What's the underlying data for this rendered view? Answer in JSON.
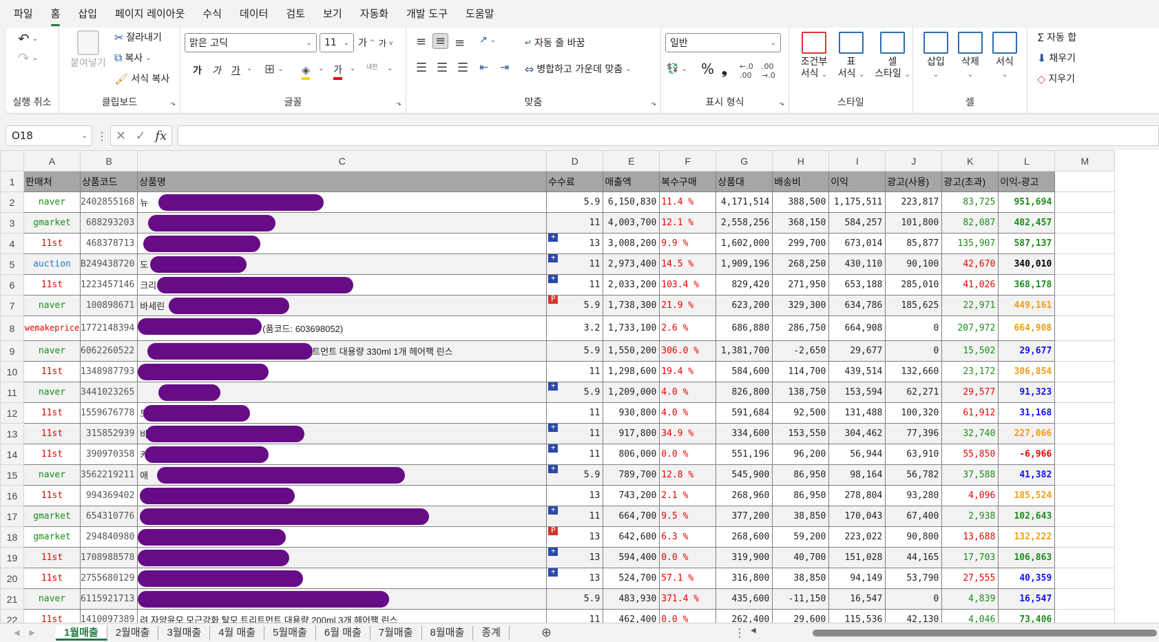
{
  "menu": [
    "파일",
    "홈",
    "삽입",
    "페이지 레이아웃",
    "수식",
    "데이터",
    "검토",
    "보기",
    "자동화",
    "개발 도구",
    "도움말"
  ],
  "ribbon": {
    "undo_group": "실행 취소",
    "clipboard_group": "클립보드",
    "paste": "붙여넣기",
    "cut": "잘라내기",
    "copy": "복사",
    "format_painter": "서식 복사",
    "font_group": "글꼴",
    "font_name": "맑은 고딕",
    "font_size": "11",
    "bold": "가",
    "italic": "가",
    "underline": "가",
    "font_color": "가",
    "phonetic": "내천",
    "align_group": "맞춤",
    "wrap_text": "자동 줄 바꿈",
    "merge_center": "병합하고 가운데 맞춤",
    "number_group": "표시 형식",
    "number_format": "일반",
    "percent": "%",
    "comma": "❟",
    "style_group": "스타일",
    "conditional": [
      "조건부",
      "서식"
    ],
    "table_fmt": [
      "표",
      "서식"
    ],
    "cell_style": [
      "셀",
      "스타일"
    ],
    "cells_group": "셀",
    "insert": "삽입",
    "delete": "삭제",
    "format": "서식",
    "autosum": "자동 합",
    "fill": "채우기",
    "clear": "지우기"
  },
  "formula_bar": {
    "name_box": "O18",
    "fx": "fx"
  },
  "columns": [
    "A",
    "B",
    "C",
    "D",
    "E",
    "F",
    "G",
    "H",
    "I",
    "J",
    "K",
    "L",
    "M"
  ],
  "header_row": [
    "판매처",
    "상품코드",
    "상품명",
    "수수료",
    "매출액",
    "복수구매",
    "상품대",
    "배송비",
    "이익",
    "광고(사용)",
    "광고(초과)",
    "이익-광고"
  ],
  "rows": [
    {
      "n": "2",
      "seller": "naver",
      "sc": "green",
      "code": "2402855168",
      "name": "뉴",
      "rw": 240,
      "rl": 30,
      "mark": "",
      "fee": "5.9",
      "sales": "6,150,830",
      "multi": "11.4 %",
      "goods": "4,171,514",
      "ship": "388,500",
      "profit": "1,175,511",
      "ad": "223,817",
      "over": "83,725",
      "net": "951,694",
      "nc": "green"
    },
    {
      "n": "3",
      "seller": "gmarket",
      "sc": "green",
      "code": "688293203",
      "name": "",
      "rw": 185,
      "rl": 15,
      "mark": "",
      "fee": "11",
      "sales": "4,003,700",
      "multi": "12.1 %",
      "goods": "2,558,256",
      "ship": "368,150",
      "profit": "584,257",
      "ad": "101,800",
      "over": "82,087",
      "net": "482,457",
      "nc": "green"
    },
    {
      "n": "4",
      "seller": "11st",
      "sc": "red",
      "code": "468378713",
      "name": "",
      "rw": 170,
      "rl": 8,
      "mark": "plus",
      "fee": "13",
      "sales": "3,008,200",
      "multi": "9.9 %",
      "goods": "1,602,000",
      "ship": "299,700",
      "profit": "673,014",
      "ad": "85,877",
      "over": "135,907",
      "net": "587,137",
      "nc": "green"
    },
    {
      "n": "5",
      "seller": "auction",
      "sc": "blue2",
      "code": "B249438720",
      "name": "도",
      "rw": 140,
      "rl": 18,
      "mark": "plus",
      "fee": "11",
      "sales": "2,973,400",
      "multi": "14.5 %",
      "goods": "1,909,196",
      "ship": "268,250",
      "profit": "430,110",
      "ad": "90,100",
      "over": "42,670",
      "net": "340,010",
      "nc": "dk"
    },
    {
      "n": "6",
      "seller": "11st",
      "sc": "red",
      "code": "1223457146",
      "name": "크리",
      "rw": 285,
      "rl": 28,
      "mark": "plus",
      "fee": "11",
      "sales": "2,033,200",
      "multi": "103.4 %",
      "goods": "829,420",
      "ship": "271,950",
      "profit": "653,188",
      "ad": "285,010",
      "over": "41,026",
      "net": "368,178",
      "nc": "green"
    },
    {
      "n": "7",
      "seller": "naver",
      "sc": "green",
      "code": "100898671",
      "name": "바세린",
      "rw": 175,
      "rl": 45,
      "mark": "p",
      "fee": "5.9",
      "sales": "1,738,300",
      "multi": "21.9 %",
      "goods": "623,200",
      "ship": "329,300",
      "profit": "634,786",
      "ad": "185,625",
      "over": "22,971",
      "net": "449,161",
      "nc": "orange"
    },
    {
      "n": "8",
      "seller": "wemakeprice",
      "sc": "red",
      "code": "1772148394",
      "name": "(품코드: 603698052)",
      "rw": 180,
      "rl": 0,
      "mark": "",
      "fee": "3.2",
      "sales": "1,733,100",
      "multi": "2.6 %",
      "goods": "686,880",
      "ship": "286,750",
      "profit": "664,908",
      "ad": "0",
      "over": "207,972",
      "net": "664,908",
      "nc": "orange"
    },
    {
      "n": "9",
      "seller": "naver",
      "sc": "green",
      "code": "6062260522",
      "name": "트먼트 대용량 330ml 1개 헤어팩 린스",
      "rw": 240,
      "rl": 14,
      "mark": "",
      "fee": "5.9",
      "sales": "1,550,200",
      "multi": "306.0 %",
      "goods": "1,381,700",
      "ship": "-2,650",
      "profit": "29,677",
      "ad": "0",
      "over": "15,502",
      "net": "29,677",
      "nc": "blue"
    },
    {
      "n": "10",
      "seller": "11st",
      "sc": "red",
      "code": "1348987793",
      "name": "",
      "rw": 190,
      "rl": 0,
      "mark": "",
      "fee": "11",
      "sales": "1,298,600",
      "multi": "19.4 %",
      "goods": "584,600",
      "ship": "114,700",
      "profit": "439,514",
      "ad": "132,660",
      "over": "23,172",
      "net": "306,854",
      "nc": "orange"
    },
    {
      "n": "11",
      "seller": "naver",
      "sc": "green",
      "code": "3441023265",
      "name": "",
      "rw": 90,
      "rl": 30,
      "mark": "plus",
      "fee": "5.9",
      "sales": "1,209,000",
      "multi": "4.0 %",
      "goods": "826,800",
      "ship": "138,750",
      "profit": "153,594",
      "ad": "62,271",
      "over": "29,577",
      "net": "91,323",
      "nc": "blue"
    },
    {
      "n": "12",
      "seller": "11st",
      "sc": "red",
      "code": "1559676778",
      "name": "도",
      "rw": 155,
      "rl": 8,
      "mark": "",
      "fee": "11",
      "sales": "930,800",
      "multi": "4.0 %",
      "goods": "591,684",
      "ship": "92,500",
      "profit": "131,488",
      "ad": "100,320",
      "over": "61,912",
      "net": "31,168",
      "nc": "blue"
    },
    {
      "n": "13",
      "seller": "11st",
      "sc": "red",
      "code": "315852939",
      "name": "바",
      "rw": 230,
      "rl": 12,
      "mark": "plus",
      "fee": "11",
      "sales": "917,800",
      "multi": "34.9 %",
      "goods": "334,600",
      "ship": "153,550",
      "profit": "304,462",
      "ad": "77,396",
      "over": "32,740",
      "net": "227,066",
      "nc": "orange"
    },
    {
      "n": "14",
      "seller": "11st",
      "sc": "red",
      "code": "390970358",
      "name": "카",
      "rw": 180,
      "rl": 10,
      "mark": "plus",
      "fee": "11",
      "sales": "806,000",
      "multi": "0.0 %",
      "goods": "551,196",
      "ship": "96,200",
      "profit": "56,944",
      "ad": "63,910",
      "over": "55,850",
      "net": "-6,966",
      "nc": "red"
    },
    {
      "n": "15",
      "seller": "naver",
      "sc": "green",
      "code": "3562219211",
      "name": "애",
      "rw": 360,
      "rl": 28,
      "mark": "plus",
      "fee": "5.9",
      "sales": "789,700",
      "multi": "12.8 %",
      "goods": "545,900",
      "ship": "86,950",
      "profit": "98,164",
      "ad": "56,782",
      "over": "37,588",
      "net": "41,382",
      "nc": "blue"
    },
    {
      "n": "16",
      "seller": "11st",
      "sc": "red",
      "code": "994369402",
      "name": "",
      "rw": 225,
      "rl": 3,
      "mark": "",
      "fee": "13",
      "sales": "743,200",
      "multi": "2.1 %",
      "goods": "268,960",
      "ship": "86,950",
      "profit": "278,804",
      "ad": "93,280",
      "over": "4,096",
      "net": "185,524",
      "nc": "orange"
    },
    {
      "n": "17",
      "seller": "gmarket",
      "sc": "green",
      "code": "654310776",
      "name": "",
      "rw": 420,
      "rl": 3,
      "mark": "plus",
      "fee": "11",
      "sales": "664,700",
      "multi": "9.5 %",
      "goods": "377,200",
      "ship": "38,850",
      "profit": "170,043",
      "ad": "67,400",
      "over": "2,938",
      "net": "102,643",
      "nc": "green"
    },
    {
      "n": "18",
      "seller": "gmarket",
      "sc": "green",
      "code": "294840980",
      "name": "",
      "rw": 215,
      "rl": 0,
      "mark": "p",
      "fee": "13",
      "sales": "642,600",
      "multi": "6.3 %",
      "goods": "268,600",
      "ship": "59,200",
      "profit": "223,022",
      "ad": "90,800",
      "over": "13,688",
      "net": "132,222",
      "nc": "orange"
    },
    {
      "n": "19",
      "seller": "11st",
      "sc": "red",
      "code": "1708988578",
      "name": "",
      "rw": 220,
      "rl": 0,
      "mark": "plus",
      "fee": "13",
      "sales": "594,400",
      "multi": "0.0 %",
      "goods": "319,900",
      "ship": "40,700",
      "profit": "151,028",
      "ad": "44,165",
      "over": "17,703",
      "net": "106,863",
      "nc": "green"
    },
    {
      "n": "20",
      "seller": "11st",
      "sc": "red",
      "code": "2755680129",
      "name": "",
      "rw": 240,
      "rl": 0,
      "mark": "plus",
      "fee": "13",
      "sales": "524,700",
      "multi": "57.1 %",
      "goods": "316,800",
      "ship": "38,850",
      "profit": "94,149",
      "ad": "53,790",
      "over": "27,555",
      "net": "40,359",
      "nc": "blue"
    },
    {
      "n": "21",
      "seller": "naver",
      "sc": "green",
      "code": "6115921713",
      "name": "",
      "rw": 365,
      "rl": 0,
      "mark": "",
      "fee": "5.9",
      "sales": "483,930",
      "multi": "371.4 %",
      "goods": "435,600",
      "ship": "-11,150",
      "profit": "16,547",
      "ad": "0",
      "over": "4,839",
      "net": "16,547",
      "nc": "blue"
    },
    {
      "n": "22",
      "seller": "11st",
      "sc": "red",
      "code": "1410097389",
      "name": "려 자양윤모 모근강화 탈모 트리트먼트 대용량 200ml 3개 헤어팩 린스",
      "rw": 0,
      "rl": 0,
      "mark": "",
      "fee": "11",
      "sales": "462,400",
      "multi": "0.0 %",
      "goods": "262,400",
      "ship": "29,600",
      "profit": "115,536",
      "ad": "42,130",
      "over": "4,046",
      "net": "73,406",
      "nc": "green"
    }
  ],
  "tabs": [
    "1월매출",
    "2월매출",
    "3월매출",
    "4월 매출",
    "5월매출",
    "6월 매출",
    "7월매출",
    "8월매출",
    "종계"
  ],
  "active_tab": "1월매출"
}
